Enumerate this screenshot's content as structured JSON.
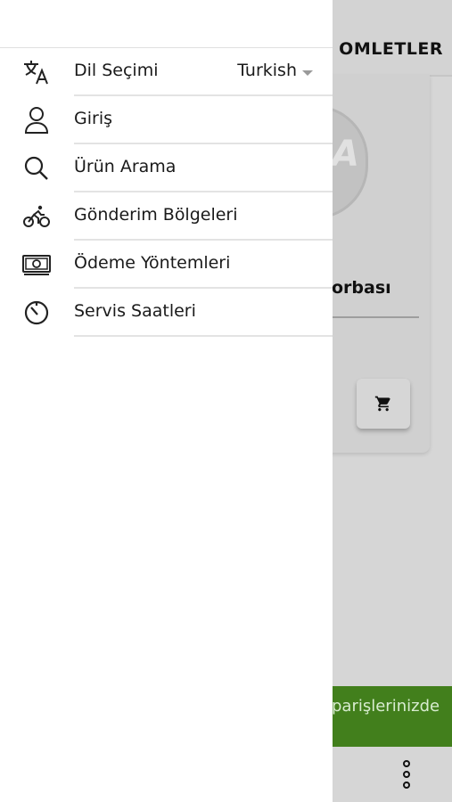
{
  "background": {
    "tab_label": "OMLETLER",
    "product_name": "orbası",
    "banner_text": "parişlerinizde",
    "logo_letters": "A",
    "banner_color": "#427f1c"
  },
  "drawer": {
    "language": {
      "label": "Dil Seçimi",
      "value": "Turkish",
      "icon": "translate-icon"
    },
    "items": [
      {
        "label": "Giriş",
        "icon": "user-icon"
      },
      {
        "label": "Ürün Arama",
        "icon": "search-icon"
      },
      {
        "label": "Gönderim Bölgeleri",
        "icon": "bicycle-icon"
      },
      {
        "label": "Ödeme Yöntemleri",
        "icon": "money-icon"
      },
      {
        "label": "Servis Saatleri",
        "icon": "timer-icon"
      }
    ]
  }
}
